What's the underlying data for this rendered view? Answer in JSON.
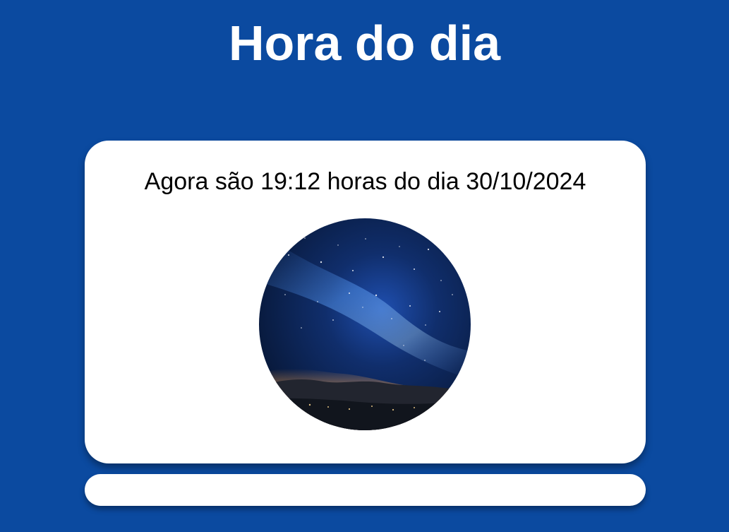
{
  "header": {
    "title": "Hora do dia"
  },
  "card": {
    "message": "Agora são 19:12 horas do dia 30/10/2024",
    "image": {
      "name": "night-sky-image"
    }
  },
  "footer": {
    "text": ""
  },
  "colors": {
    "background": "#0b4aa0",
    "card": "#ffffff",
    "title_text": "#ffffff",
    "message_text": "#000000"
  }
}
